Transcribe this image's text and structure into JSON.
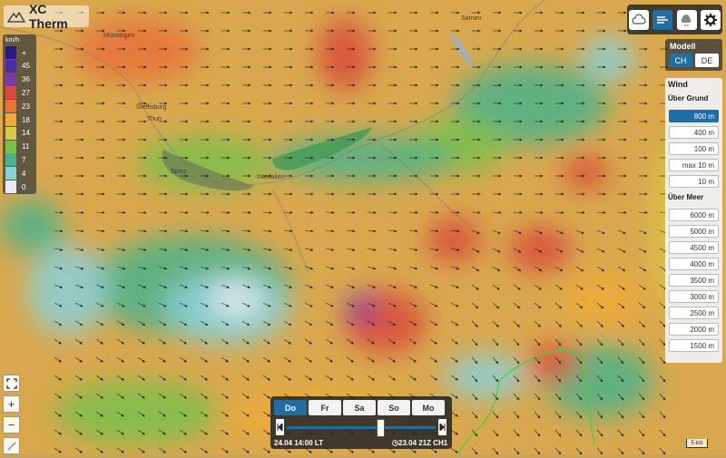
{
  "app": {
    "title": "XC Therm"
  },
  "legend": {
    "unit": "km/h",
    "rows": [
      {
        "label": "+",
        "color": "#2a1a7a"
      },
      {
        "label": "45",
        "color": "#4a2ab0"
      },
      {
        "label": "36",
        "color": "#7a3aa8"
      },
      {
        "label": "27",
        "color": "#d84a3a"
      },
      {
        "label": "23",
        "color": "#e8723a"
      },
      {
        "label": "18",
        "color": "#efaa3a"
      },
      {
        "label": "14",
        "color": "#d8c84a"
      },
      {
        "label": "11",
        "color": "#7ac04a"
      },
      {
        "label": "7",
        "color": "#4ab28a"
      },
      {
        "label": "4",
        "color": "#8ad0d8"
      },
      {
        "label": "0",
        "color": "#e8ecf0"
      }
    ]
  },
  "toolbar": {
    "icons": [
      "cloud-icon",
      "wind-icon",
      "thermal-cloud-icon",
      "gear-icon"
    ]
  },
  "model": {
    "title": "Modell",
    "options": [
      {
        "label": "CH",
        "active": true
      },
      {
        "label": "DE",
        "active": false
      }
    ]
  },
  "wind": {
    "title": "Wind",
    "ground_label": "Über Grund",
    "ground": [
      {
        "label": "800 m",
        "active": true
      },
      {
        "label": "400 m",
        "active": false
      },
      {
        "label": "100 m",
        "active": false
      },
      {
        "label": "max 10 m",
        "active": false
      },
      {
        "label": "10 m",
        "active": false
      }
    ],
    "sea_label": "Über Meer",
    "sea": [
      {
        "label": "6000 m"
      },
      {
        "label": "5000 m"
      },
      {
        "label": "4500 m"
      },
      {
        "label": "4000 m"
      },
      {
        "label": "3500 m"
      },
      {
        "label": "3000 m"
      },
      {
        "label": "2500 m"
      },
      {
        "label": "2000 m"
      },
      {
        "label": "1500 m"
      }
    ]
  },
  "zoom": {
    "in_label": "+",
    "out_label": "−"
  },
  "timebar": {
    "days": [
      {
        "label": "Do",
        "active": true
      },
      {
        "label": "Fr",
        "active": false
      },
      {
        "label": "Sa",
        "active": false
      },
      {
        "label": "So",
        "active": false
      },
      {
        "label": "Mo",
        "active": false
      }
    ],
    "current_time": "24.04 14:00 LT",
    "model_run": "23.04 21Z CH1",
    "slider_position": 0.62
  },
  "scale": {
    "label": "5 km"
  },
  "places": [
    "Münsingen",
    "Steffisburg",
    "Thun",
    "Spiez",
    "Interlaken",
    "Sarnen"
  ]
}
